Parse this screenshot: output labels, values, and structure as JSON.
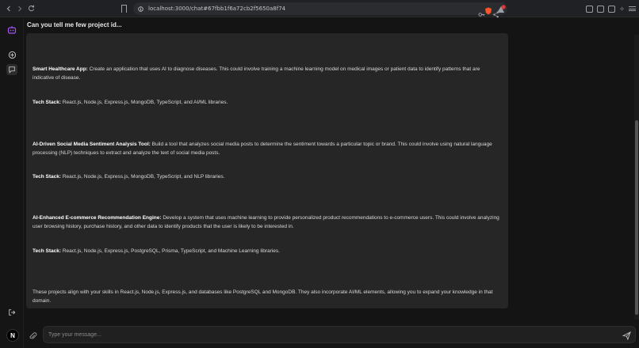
{
  "browser": {
    "url": "localhost:3000/chat#67fbb1f6a72cb2f5650a8f74"
  },
  "chat": {
    "title": "Can you tell me few project id..."
  },
  "message": {
    "p1_bold": "Smart Healthcare App:",
    "p1_text": " Create an application that uses AI to diagnose diseases. This could involve training a machine learning model on medical images or patient data to identify patterns that are indicative of disease.",
    "p2_bold": "Tech Stack:",
    "p2_text": " React.js, Node.js, Express.js, MongoDB, TypeScript, and AI/ML libraries.",
    "p3_bold": "AI-Driven Social Media Sentiment Analysis Tool:",
    "p3_text": " Build a tool that analyzes social media posts to determine the sentiment towards a particular topic or brand. This could involve using natural language processing (NLP) techniques to extract and analyze the text of social media posts.",
    "p4_bold": "Tech Stack:",
    "p4_text": " React.js, Node.js, Express.js, MongoDB, TypeScript, and NLP libraries.",
    "p5_bold": "AI-Enhanced E-commerce Recommendation Engine:",
    "p5_text": " Develop a system that uses machine learning to provide personalized product recommendations to e-commerce users. This could involve analyzing user browsing history, purchase history, and other data to identify products that the user is likely to be interested in.",
    "p6_bold": "Tech Stack:",
    "p6_text": " React.js, Node.js, Express.js, PostgreSQL, Prisma, TypeScript, and Machine Learning libraries.",
    "p7_text": "These projects align with your skills in React.js, Node.js, Express.js, and databases like PostgreSQL and MongoDB. They also incorporate AI/ML elements, allowing you to expand your knowledge in that domain."
  },
  "composer": {
    "placeholder": "Type your message..."
  },
  "user": {
    "avatar_initial": "N"
  },
  "icons": {
    "back": "chevron-left-icon",
    "forward": "chevron-right-icon",
    "reload": "reload-icon",
    "bookmark": "bookmark-icon",
    "site_info": "site-info-icon",
    "key": "key-icon",
    "share": "share-icon",
    "brave": "brave-shield-icon",
    "notification": "notification-icon",
    "app_logo": "robot-icon",
    "new_chat": "plus-circle-icon",
    "chats": "chat-bubble-icon",
    "logout": "logout-icon",
    "attach": "paperclip-icon",
    "send": "send-icon"
  },
  "colors": {
    "accent": "#a855f7",
    "brave": "#fb542b",
    "notification_badge": "#e53935"
  }
}
